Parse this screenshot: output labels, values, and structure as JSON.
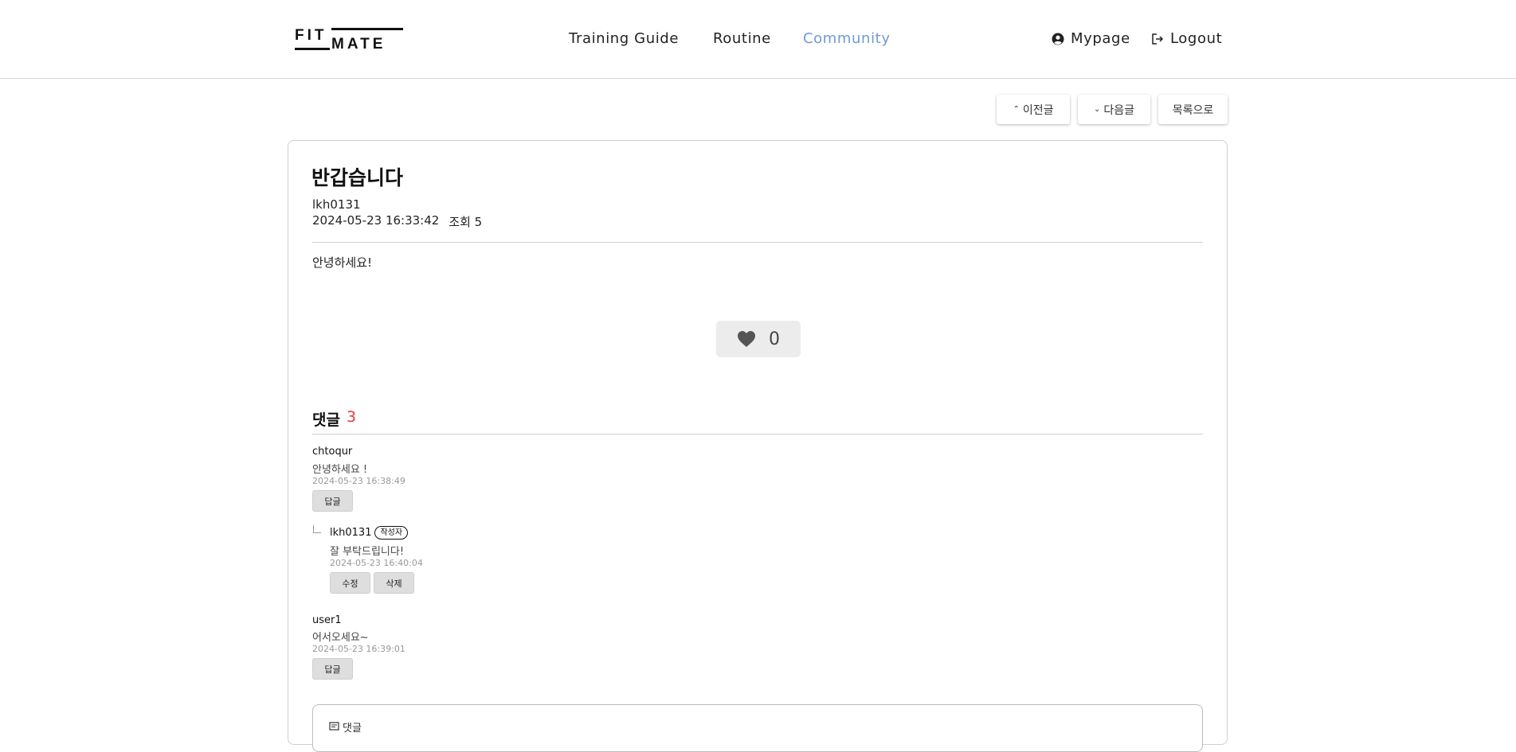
{
  "header": {
    "logo_text": "FIT MATE",
    "nav": [
      "Training Guide",
      "Routine",
      "Community"
    ],
    "mypage_label": "Mypage",
    "logout_label": "Logout"
  },
  "post_nav": {
    "prev_label": "이전글",
    "next_label": "다음글",
    "list_label": "목록으로"
  },
  "post": {
    "title": "반갑습니다",
    "author": "lkh0131",
    "datetime": "2024-05-23 16:33:42",
    "views": "조회 5",
    "body": "안녕하세요!",
    "likes": "0"
  },
  "comments_section": {
    "heading": "댓글",
    "count": "3",
    "author_badge": "작성자",
    "reply_label": "답글",
    "edit_label": "수정",
    "delete_label": "삭제",
    "write_label": "댓글"
  },
  "comments": [
    {
      "user": "chtoqur",
      "text": "안녕하세요 !",
      "date": "2024-05-23 16:38:49"
    },
    {
      "user": "lkh0131",
      "text": "잘 부탁드립니다!",
      "date": "2024-05-23 16:40:04"
    },
    {
      "user": "user1",
      "text": "어서오세요~",
      "date": "2024-05-23 16:39:01"
    }
  ],
  "colors": {
    "accent": "#6f9bd1",
    "comment_count": "#e03a3a",
    "like_bg": "#ececec"
  }
}
